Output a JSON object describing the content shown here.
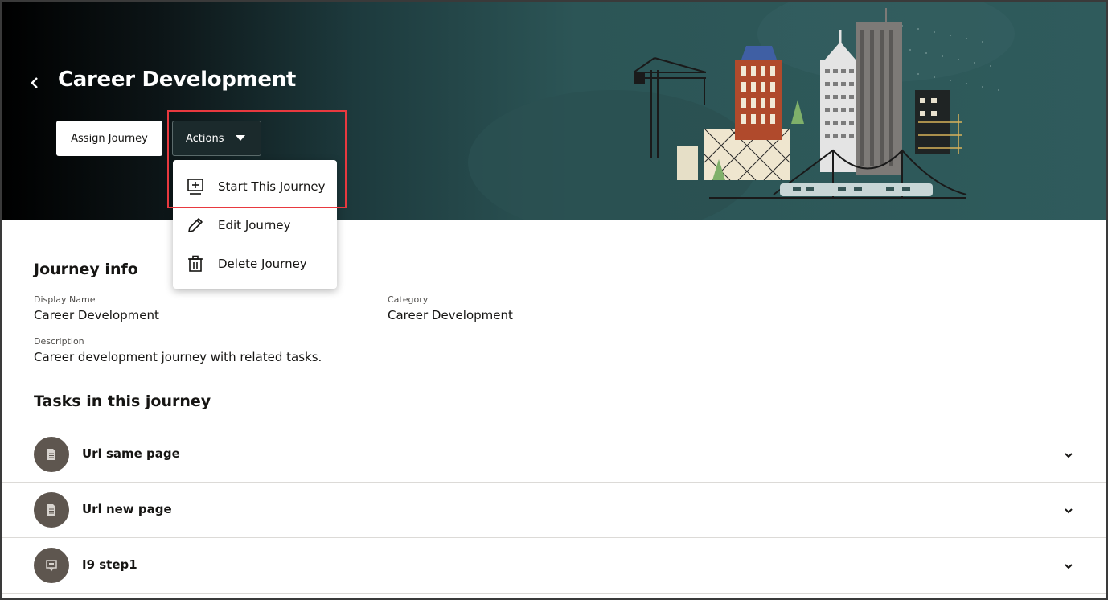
{
  "header": {
    "title": "Career Development",
    "back_icon": "chevron-left-icon",
    "assign_button": "Assign Journey",
    "actions_button": "Actions",
    "actions_caret_icon": "caret-down-icon"
  },
  "actions_menu": {
    "items": [
      {
        "label": "Start This Journey",
        "icon": "add-screen-icon"
      },
      {
        "label": "Edit Journey",
        "icon": "pencil-icon"
      },
      {
        "label": "Delete Journey",
        "icon": "trash-icon"
      }
    ]
  },
  "journey_info": {
    "heading": "Journey info",
    "display_name_label": "Display Name",
    "display_name_value": "Career Development",
    "category_label": "Category",
    "category_value": "Career Development",
    "description_label": "Description",
    "description_value": "Career development journey with related tasks."
  },
  "tasks": {
    "heading": "Tasks in this journey",
    "items": [
      {
        "name": "Url same page",
        "icon": "document-icon"
      },
      {
        "name": "Url new page",
        "icon": "document-icon"
      },
      {
        "name": "I9 step1",
        "icon": "form-icon"
      }
    ]
  },
  "colors": {
    "banner_teal": "#2f5b5c",
    "highlight_red": "#e8393f",
    "avatar_brown": "#5e564f"
  }
}
